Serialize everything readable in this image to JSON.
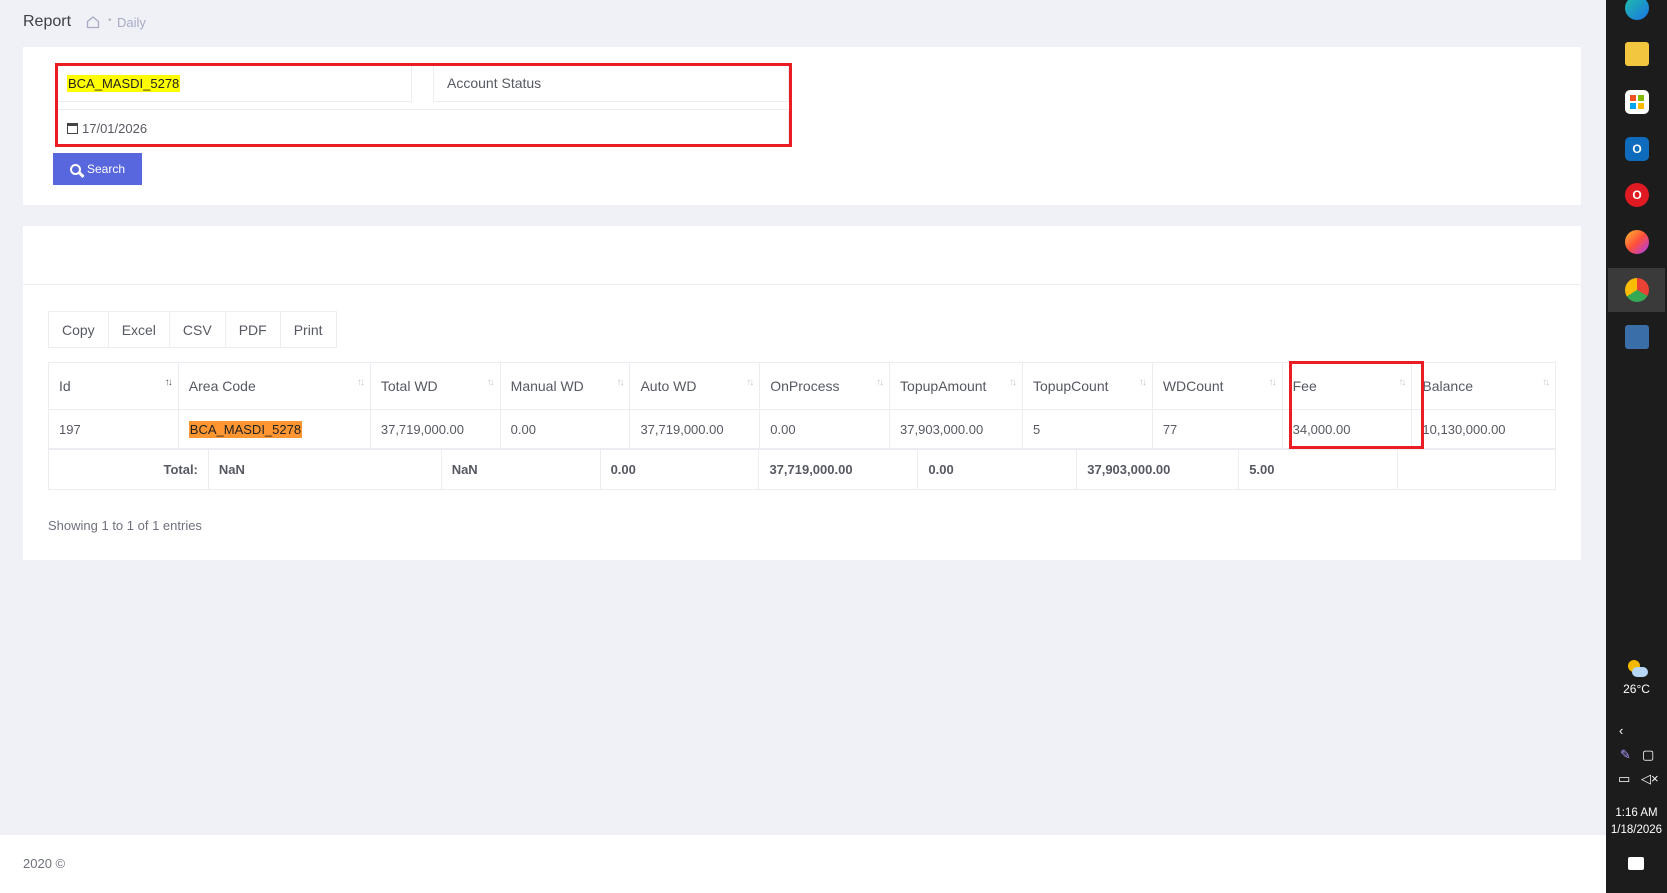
{
  "header": {
    "title": "Report",
    "breadcrumb_current": "Daily"
  },
  "filter": {
    "area_code_value": "BCA_MASDI_5278",
    "account_status_placeholder": "Account Status",
    "date_value": "17/01/2026",
    "search_label": "Search"
  },
  "export_buttons": [
    "Copy",
    "Excel",
    "CSV",
    "PDF",
    "Print"
  ],
  "table": {
    "columns": [
      "Id",
      "Area Code",
      "Total WD",
      "Manual WD",
      "Auto WD",
      "OnProcess",
      "TopupAmount",
      "TopupCount",
      "WDCount",
      "Fee",
      "Balance"
    ],
    "rows": [
      [
        "197",
        "BCA_MASDI_5278",
        "37,719,000.00",
        "0.00",
        "37,719,000.00",
        "0.00",
        "37,903,000.00",
        "5",
        "77",
        "34,000.00",
        "10,130,000.00"
      ]
    ],
    "totals": {
      "label": "Total:",
      "values": [
        "NaN",
        "NaN",
        "0.00",
        "37,719,000.00",
        "0.00",
        "37,903,000.00",
        "5.00",
        "",
        ""
      ]
    }
  },
  "entries_info": "Showing 1 to 1 of 1 entries",
  "footer": "2020 ©",
  "taskbar": {
    "weather_temp": "26°C",
    "time": "1:16 AM",
    "date": "1/18/2026"
  },
  "colors": {
    "accent": "#5867dd",
    "highlight_yellow": "#ffff00",
    "highlight_orange": "#ff9632",
    "annotation_red": "#ea1c24"
  }
}
